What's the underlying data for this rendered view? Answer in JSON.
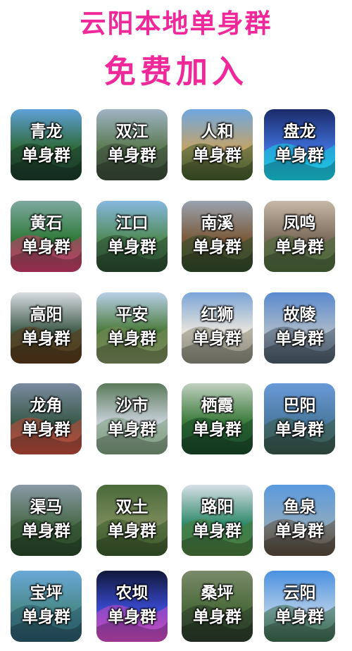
{
  "header": {
    "title_line1": "云阳本地单身群",
    "title_line2": "免费加入",
    "title_color": "#f0299a"
  },
  "group_suffix": "单身群",
  "groups": [
    {
      "name": "青龙"
    },
    {
      "name": "双江"
    },
    {
      "name": "人和"
    },
    {
      "name": "盘龙"
    },
    {
      "name": "黄石"
    },
    {
      "name": "江口"
    },
    {
      "name": "南溪"
    },
    {
      "name": "凤鸣"
    },
    {
      "name": "高阳"
    },
    {
      "name": "平安"
    },
    {
      "name": "红狮"
    },
    {
      "name": "故陵"
    },
    {
      "name": "龙角"
    },
    {
      "name": "沙市"
    },
    {
      "name": "栖霞"
    },
    {
      "name": "巴阳"
    },
    {
      "name": "渠马"
    },
    {
      "name": "双土"
    },
    {
      "name": "路阳"
    },
    {
      "name": "鱼泉"
    },
    {
      "name": "宝坪"
    },
    {
      "name": "农坝"
    },
    {
      "name": "桑坪"
    },
    {
      "name": "云阳"
    }
  ]
}
